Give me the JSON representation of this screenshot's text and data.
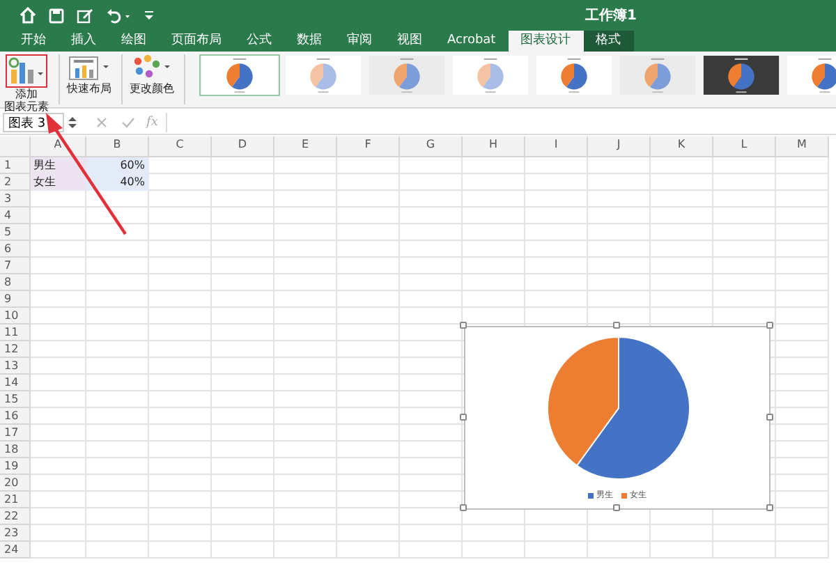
{
  "window": {
    "title": "工作簿1"
  },
  "tabs": [
    {
      "label": "开始",
      "selected": false,
      "contextual": false
    },
    {
      "label": "插入",
      "selected": false,
      "contextual": false
    },
    {
      "label": "绘图",
      "selected": false,
      "contextual": false
    },
    {
      "label": "页面布局",
      "selected": false,
      "contextual": false
    },
    {
      "label": "公式",
      "selected": false,
      "contextual": false
    },
    {
      "label": "数据",
      "selected": false,
      "contextual": false
    },
    {
      "label": "审阅",
      "selected": false,
      "contextual": false
    },
    {
      "label": "视图",
      "selected": false,
      "contextual": false
    },
    {
      "label": "Acrobat",
      "selected": false,
      "contextual": false
    },
    {
      "label": "图表设计",
      "selected": true,
      "contextual": true
    },
    {
      "label": "格式",
      "selected": false,
      "contextual": true
    }
  ],
  "ribbon": {
    "buttons": [
      {
        "kind": "add-element",
        "label_lines": [
          "添加",
          "图表元素"
        ]
      },
      {
        "kind": "layout",
        "label_lines": [
          "快速布局"
        ]
      },
      {
        "kind": "colors",
        "label_lines": [
          "更改颜色"
        ]
      }
    ],
    "chart_styles": [
      {
        "kind": "standard",
        "selected": true
      },
      {
        "kind": "faded",
        "selected": false
      },
      {
        "kind": "gray",
        "selected": false
      },
      {
        "kind": "faded",
        "selected": false
      },
      {
        "kind": "standard",
        "selected": false
      },
      {
        "kind": "gray",
        "selected": false
      },
      {
        "kind": "dark",
        "selected": false
      },
      {
        "kind": "standard",
        "selected": false
      }
    ]
  },
  "formula_bar": {
    "name_box": "图表 3",
    "function_label": "fx"
  },
  "sheet": {
    "columns": [
      "A",
      "B",
      "C",
      "D",
      "E",
      "F",
      "G",
      "H",
      "I",
      "J",
      "K",
      "L",
      "M"
    ],
    "rows": [
      {
        "label": "1",
        "cells": [
          {
            "kind": "text",
            "text": "男生"
          },
          {
            "kind": "number",
            "text": "60%"
          }
        ]
      },
      {
        "label": "2",
        "cells": [
          {
            "kind": "text",
            "text": "女生"
          },
          {
            "kind": "number",
            "text": "40%"
          }
        ]
      },
      {
        "label": "3"
      },
      {
        "label": "4"
      },
      {
        "label": "5"
      },
      {
        "label": "6"
      },
      {
        "label": "7"
      },
      {
        "label": "8"
      },
      {
        "label": "9"
      },
      {
        "label": "10"
      },
      {
        "label": "11"
      },
      {
        "label": "12"
      },
      {
        "label": "13"
      },
      {
        "label": "14"
      },
      {
        "label": "15"
      },
      {
        "label": "16"
      },
      {
        "label": "17"
      },
      {
        "label": "18"
      },
      {
        "label": "19"
      },
      {
        "label": "20"
      },
      {
        "label": "21"
      },
      {
        "label": "22"
      },
      {
        "label": "23"
      },
      {
        "label": "24"
      }
    ]
  },
  "chart": {
    "chart_data": {
      "type": "pie",
      "categories": [
        "男生",
        "女生"
      ],
      "legend": "bottom",
      "series": [
        {
          "values": [
            60,
            40
          ],
          "colors": [
            "#4472c4",
            "#ed7d31"
          ]
        }
      ]
    }
  }
}
